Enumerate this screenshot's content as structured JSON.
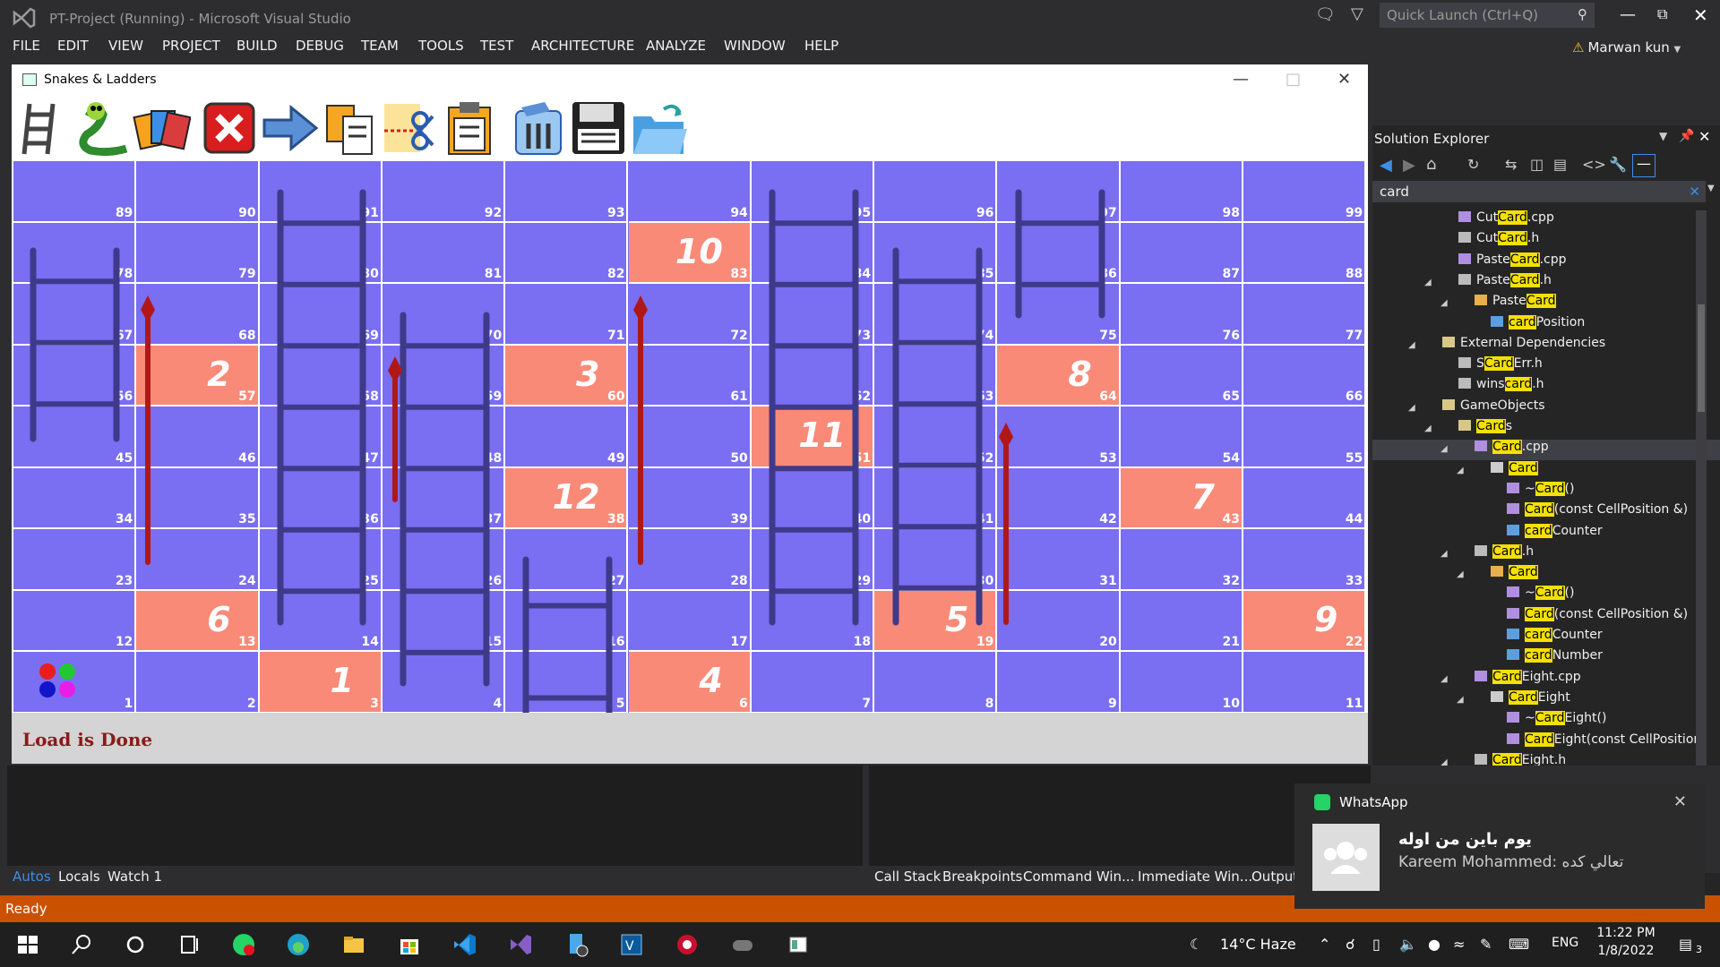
{
  "vs": {
    "title": "PT-Project (Running) - Microsoft Visual Studio",
    "quick_launch": "Quick Launch (Ctrl+Q)",
    "menu": [
      "FILE",
      "EDIT",
      "VIEW",
      "PROJECT",
      "BUILD",
      "DEBUG",
      "TEAM",
      "TOOLS",
      "TEST",
      "ARCHITECTURE",
      "ANALYZE",
      "WINDOW",
      "HELP"
    ],
    "user": "Marwan kun"
  },
  "game": {
    "title": "Snakes & Ladders",
    "status": "Load is Done",
    "toolbar_icons": [
      "ladder-icon",
      "snake-icon",
      "cards-icon",
      "delete-icon",
      "arrow-icon",
      "copy-icon",
      "cut-icon",
      "paste-icon",
      "clipboard-icon",
      "save-icon",
      "open-icon"
    ],
    "rows": [
      [
        89,
        90,
        91,
        92,
        93,
        94,
        95,
        96,
        97,
        98,
        99
      ],
      [
        78,
        79,
        80,
        81,
        82,
        83,
        84,
        85,
        86,
        87,
        88
      ],
      [
        67,
        68,
        69,
        70,
        71,
        72,
        73,
        74,
        75,
        76,
        77
      ],
      [
        56,
        57,
        58,
        59,
        60,
        61,
        62,
        63,
        64,
        65,
        66
      ],
      [
        45,
        46,
        47,
        48,
        49,
        50,
        51,
        52,
        53,
        54,
        55
      ],
      [
        34,
        35,
        36,
        37,
        38,
        39,
        40,
        41,
        42,
        43,
        44
      ],
      [
        23,
        24,
        25,
        26,
        27,
        28,
        29,
        30,
        31,
        32,
        33
      ],
      [
        12,
        13,
        14,
        15,
        16,
        17,
        18,
        19,
        20,
        21,
        22
      ],
      [
        1,
        2,
        3,
        4,
        5,
        6,
        7,
        8,
        9,
        10,
        11
      ]
    ],
    "cards": {
      "83": "10",
      "57": "2",
      "60": "3",
      "64": "8",
      "51": "11",
      "38": "12",
      "43": "7",
      "13": "6",
      "19": "5",
      "22": "9",
      "3": "1",
      "6": "4"
    },
    "colors": {
      "board": "#7a6ef2",
      "card": "#f98a78",
      "ladder": "#3e3a8a",
      "snake": "#b01818"
    }
  },
  "solution_explorer": {
    "title": "Solution Explorer",
    "search": "card",
    "items": [
      {
        "pre": "Cut",
        "hl": "Card",
        "post": ".cpp"
      },
      {
        "pre": "Cut",
        "hl": "Card",
        "post": ".h"
      },
      {
        "pre": "Paste",
        "hl": "Card",
        "post": ".cpp"
      },
      {
        "pre": "Paste",
        "hl": "Card",
        "post": ".h"
      },
      {
        "pre": "Paste",
        "hl": "Card",
        "post": ""
      },
      {
        "pre": "",
        "hl": "card",
        "post": "Position"
      },
      {
        "pre": "External Dependencies",
        "hl": "",
        "post": ""
      },
      {
        "pre": "S",
        "hl": "Card",
        "post": "Err.h"
      },
      {
        "pre": "wins",
        "hl": "card",
        "post": ".h"
      },
      {
        "pre": "GameObjects",
        "hl": "",
        "post": ""
      },
      {
        "pre": "",
        "hl": "Card",
        "post": "s"
      },
      {
        "pre": "",
        "hl": "Card",
        "post": ".cpp"
      },
      {
        "pre": "",
        "hl": "Card",
        "post": ""
      },
      {
        "pre": "~",
        "hl": "Card",
        "post": "()"
      },
      {
        "pre": "",
        "hl": "Card",
        "post": "(const CellPosition &)"
      },
      {
        "pre": "",
        "hl": "card",
        "post": "Counter"
      },
      {
        "pre": "",
        "hl": "Card",
        "post": ".h"
      },
      {
        "pre": "",
        "hl": "Card",
        "post": ""
      },
      {
        "pre": "~",
        "hl": "Card",
        "post": "()"
      },
      {
        "pre": "",
        "hl": "Card",
        "post": "(const CellPosition &)"
      },
      {
        "pre": "",
        "hl": "card",
        "post": "Counter"
      },
      {
        "pre": "",
        "hl": "card",
        "post": "Number"
      },
      {
        "pre": "",
        "hl": "Card",
        "post": "Eight.cpp"
      },
      {
        "pre": "",
        "hl": "Card",
        "post": "Eight"
      },
      {
        "pre": "~",
        "hl": "Card",
        "post": "Eight()"
      },
      {
        "pre": "",
        "hl": "Card",
        "post": "Eight(const CellPosition"
      },
      {
        "pre": "",
        "hl": "Card",
        "post": "Eight.h"
      }
    ]
  },
  "bottom_tabs": {
    "left": [
      "Autos",
      "Locals",
      "Watch 1"
    ],
    "right": [
      "Call Stack",
      "Breakpoints",
      "Command Win...",
      "Immediate Win...",
      "Output"
    ]
  },
  "statusbar": {
    "text": "Ready"
  },
  "taskbar": {
    "weather": "14°C  Haze",
    "lang": "ENG",
    "time": "11:22 PM",
    "date": "1/8/2022",
    "notif_count": "3"
  },
  "toast": {
    "app": "WhatsApp",
    "title": "يوم باين من اوله",
    "message": "Kareem Mohammed: تعالي كده"
  }
}
